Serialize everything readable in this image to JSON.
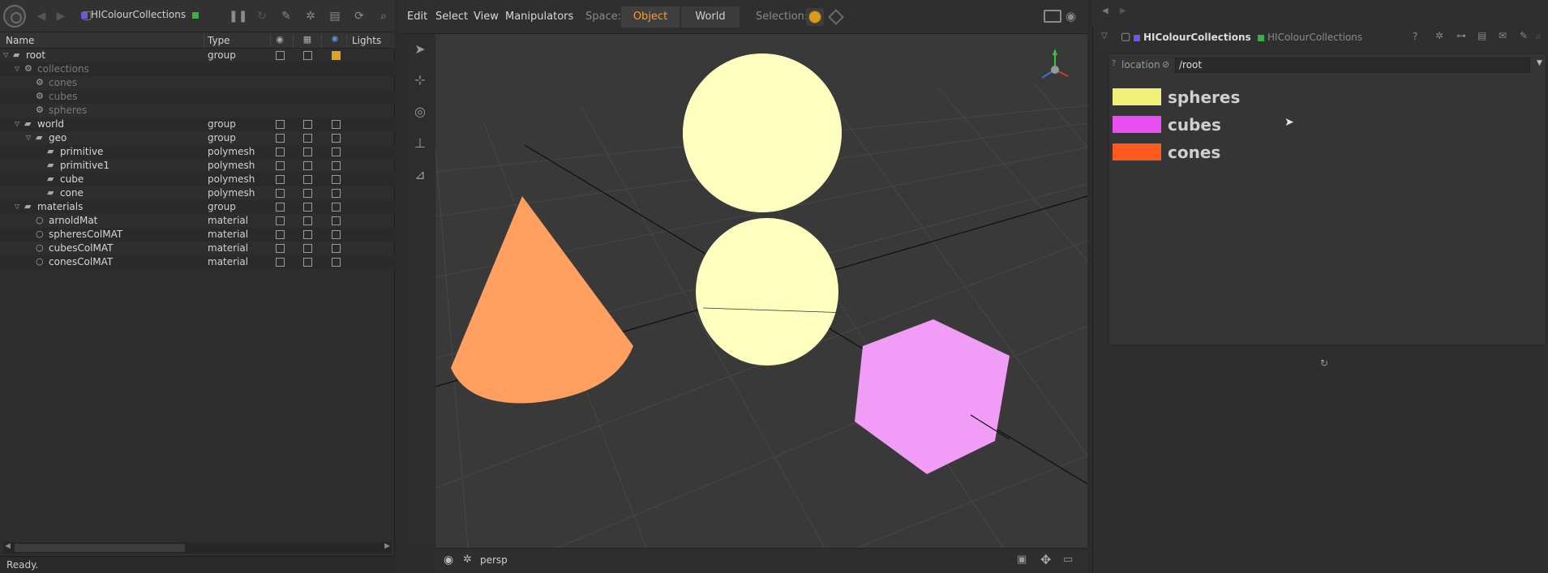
{
  "left_panel": {
    "node_title": "HIColourCollections",
    "columns": {
      "name": "Name",
      "type": "Type",
      "lights": "Lights"
    },
    "status": "Ready.",
    "rows": [
      {
        "name": "root",
        "type": "group",
        "muted": false,
        "cb": [
          false,
          false,
          true
        ]
      },
      {
        "name": "collections",
        "type": "",
        "muted": true,
        "cb": null
      },
      {
        "name": "cones",
        "type": "",
        "muted": true,
        "cb": null
      },
      {
        "name": "cubes",
        "type": "",
        "muted": true,
        "cb": null
      },
      {
        "name": "spheres",
        "type": "",
        "muted": true,
        "cb": null
      },
      {
        "name": "world",
        "type": "group",
        "muted": false,
        "cb": [
          false,
          false,
          false
        ]
      },
      {
        "name": "geo",
        "type": "group",
        "muted": false,
        "cb": [
          false,
          false,
          false
        ]
      },
      {
        "name": "primitive",
        "type": "polymesh",
        "muted": false,
        "cb": [
          false,
          false,
          false
        ]
      },
      {
        "name": "primitive1",
        "type": "polymesh",
        "muted": false,
        "cb": [
          false,
          false,
          false
        ]
      },
      {
        "name": "cube",
        "type": "polymesh",
        "muted": false,
        "cb": [
          false,
          false,
          false
        ]
      },
      {
        "name": "cone",
        "type": "polymesh",
        "muted": false,
        "cb": [
          false,
          false,
          false
        ]
      },
      {
        "name": "materials",
        "type": "group",
        "muted": false,
        "cb": [
          false,
          false,
          false
        ]
      },
      {
        "name": "arnoldMat",
        "type": "material",
        "muted": false,
        "cb": [
          false,
          false,
          false
        ]
      },
      {
        "name": "spheresColMAT",
        "type": "material",
        "muted": false,
        "cb": [
          false,
          false,
          false
        ]
      },
      {
        "name": "cubesColMAT",
        "type": "material",
        "muted": false,
        "cb": [
          false,
          false,
          false
        ]
      },
      {
        "name": "conesColMAT",
        "type": "material",
        "muted": false,
        "cb": [
          false,
          false,
          false
        ]
      }
    ]
  },
  "viewer": {
    "menus": [
      "Edit",
      "Select",
      "View",
      "Manipulators"
    ],
    "space_label": "Space:",
    "space_options": [
      "Object",
      "World"
    ],
    "space_selected": "Object",
    "selection_label": "Selection:",
    "camera": "persp",
    "colors": {
      "sphere": "#ffffc0",
      "cone": "#ffa060",
      "cube": "#f19cf6",
      "grid": "#4a4a4a",
      "background": "#393939"
    }
  },
  "param_panel": {
    "node_name": "HIColourCollections",
    "node_type": "HIColourCollections",
    "location_label": "location",
    "location_value": "/root",
    "collections": [
      {
        "name": "spheres",
        "color": "#f0f07a"
      },
      {
        "name": "cubes",
        "color": "#e84ff0"
      },
      {
        "name": "cones",
        "color": "#ff5a1e"
      }
    ]
  }
}
